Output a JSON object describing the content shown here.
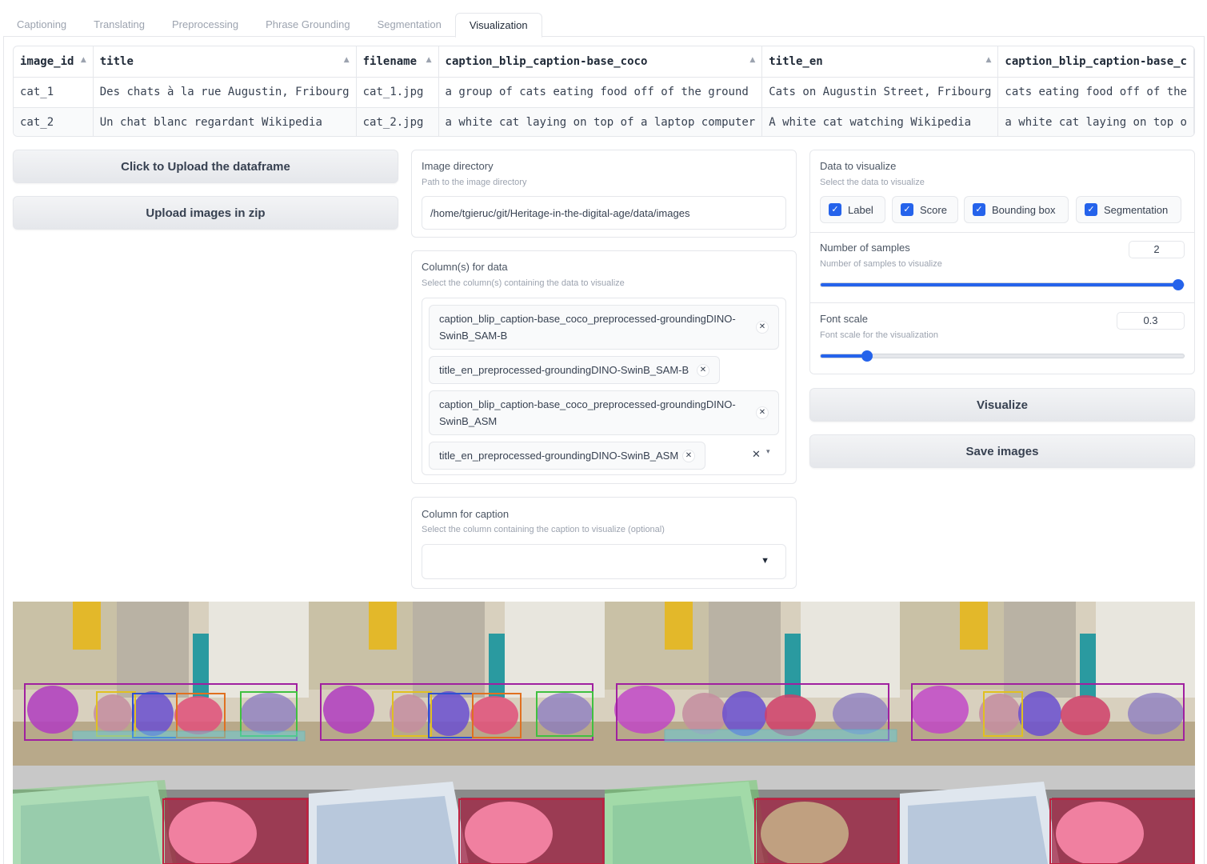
{
  "tabs": [
    {
      "label": "Captioning"
    },
    {
      "label": "Translating"
    },
    {
      "label": "Preprocessing"
    },
    {
      "label": "Phrase Grounding"
    },
    {
      "label": "Segmentation"
    },
    {
      "label": "Visualization",
      "active": true
    }
  ],
  "table": {
    "headers": [
      "image_id",
      "title",
      "filename",
      "caption_blip_caption-base_coco",
      "title_en",
      "caption_blip_caption-base_c"
    ],
    "rows": [
      [
        "cat_1",
        "Des chats à la rue Augustin, Fribourg",
        "cat_1.jpg",
        "a group of cats eating food off of the ground",
        "Cats on Augustin Street, Fribourg",
        "cats eating food off of the"
      ],
      [
        "cat_2",
        "Un chat blanc regardant Wikipedia",
        "cat_2.jpg",
        "a white cat laying on top of a laptop computer",
        "A white cat watching Wikipedia",
        "a white cat laying on top o"
      ]
    ]
  },
  "buttons": {
    "upload_df": "Click to Upload the dataframe",
    "upload_zip": "Upload images in zip",
    "visualize": "Visualize",
    "save": "Save images"
  },
  "image_dir": {
    "label": "Image directory",
    "info": "Path to the image directory",
    "value": "/home/tgieruc/git/Heritage-in-the-digital-age/data/images"
  },
  "columns_data": {
    "label": "Column(s) for data",
    "info": "Select the column(s) containing the data to visualize",
    "chips": [
      {
        "line1": "caption_blip_caption-base_coco_preprocessed-groundingDINO-",
        "line2": "SwinB_SAM-B"
      },
      {
        "line1": "title_en_preprocessed-groundingDINO-SwinB_SAM-B",
        "line2": ""
      },
      {
        "line1": "caption_blip_caption-base_coco_preprocessed-groundingDINO-",
        "line2": "SwinB_ASM"
      },
      {
        "line1": "title_en_preprocessed-groundingDINO-SwinB_ASM",
        "line2": ""
      }
    ]
  },
  "column_caption": {
    "label": "Column for caption",
    "info": "Select the column containing the caption to visualize (optional)",
    "value": ""
  },
  "data_to_visualize": {
    "label": "Data to visualize",
    "info": "Select the data to visualize",
    "options": [
      {
        "label": "Label",
        "checked": true
      },
      {
        "label": "Score",
        "checked": true
      },
      {
        "label": "Bounding box",
        "checked": true
      },
      {
        "label": "Segmentation",
        "checked": true
      }
    ]
  },
  "num_samples": {
    "label": "Number of samples",
    "info": "Number of samples to visualize",
    "value": "2",
    "fraction": 1.0
  },
  "font_scale": {
    "label": "Font scale",
    "info": "Font scale for the visualization",
    "value": "0.3",
    "fraction": 0.115
  },
  "colors": {
    "accent": "#2563eb",
    "border": "#e5e7eb"
  }
}
